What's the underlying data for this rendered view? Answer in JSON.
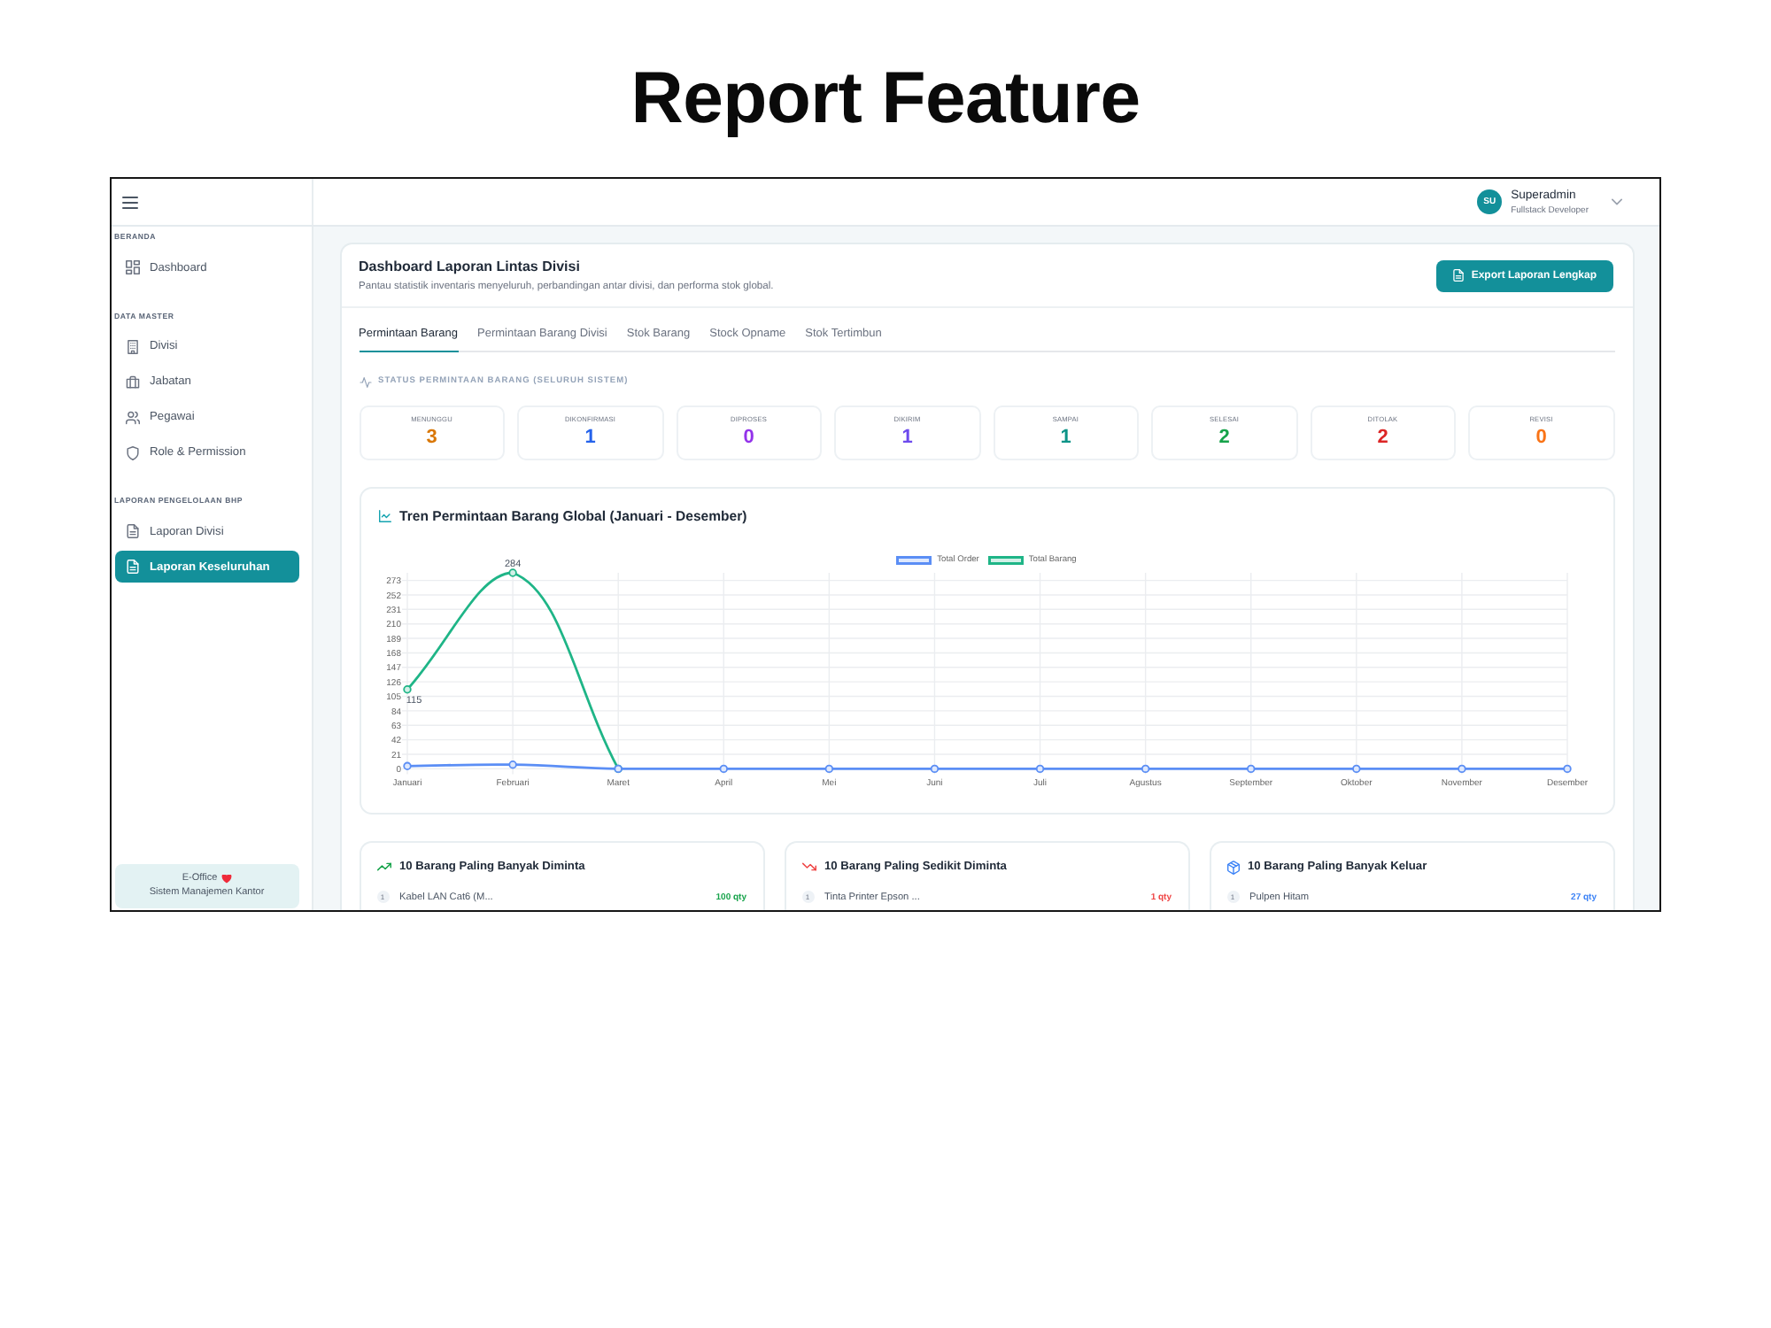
{
  "page_title": "Report Feature",
  "header": {
    "avatar_initials": "SU",
    "user_name": "Superadmin",
    "user_role": "Fullstack Developer"
  },
  "sidebar": {
    "groups": [
      {
        "label": "BERANDA",
        "items": [
          {
            "label": "Dashboard",
            "selected": false
          }
        ]
      },
      {
        "label": "DATA MASTER",
        "items": [
          {
            "label": "Divisi",
            "selected": false
          },
          {
            "label": "Jabatan",
            "selected": false
          },
          {
            "label": "Pegawai",
            "selected": false
          },
          {
            "label": "Role & Permission",
            "selected": false
          }
        ]
      },
      {
        "label": "LAPORAN PENGELOLAAN BHP",
        "items": [
          {
            "label": "Laporan Divisi",
            "selected": false
          },
          {
            "label": "Laporan Keseluruhan",
            "selected": true
          }
        ]
      }
    ],
    "footer": {
      "app_name": "E-Office",
      "tagline": "Sistem Manajemen Kantor"
    }
  },
  "report": {
    "title": "Dashboard Laporan Lintas Divisi",
    "subtitle": "Pantau statistik inventaris menyeluruh, perbandingan antar divisi, dan performa stok global.",
    "export_button": "Export Laporan Lengkap",
    "tabs": [
      {
        "label": "Permintaan Barang",
        "selected": true
      },
      {
        "label": "Permintaan Barang Divisi",
        "selected": false
      },
      {
        "label": "Stok Barang",
        "selected": false
      },
      {
        "label": "Stock Opname",
        "selected": false
      },
      {
        "label": "Stok Tertimbun",
        "selected": false
      }
    ],
    "status_section": {
      "heading": "STATUS PERMINTAAN BARANG (SELURUH SISTEM)",
      "items": [
        {
          "label": "MENUNGGU",
          "value": "3",
          "color": "#d97706"
        },
        {
          "label": "DIKONFIRMASI",
          "value": "1",
          "color": "#2563eb"
        },
        {
          "label": "DIPROSES",
          "value": "0",
          "color": "#9333ea"
        },
        {
          "label": "DIKIRIM",
          "value": "1",
          "color": "#6d4aed"
        },
        {
          "label": "SAMPAI",
          "value": "1",
          "color": "#0d9488"
        },
        {
          "label": "SELESAI",
          "value": "2",
          "color": "#16a34a"
        },
        {
          "label": "DITOLAK",
          "value": "2",
          "color": "#dc2626"
        },
        {
          "label": "REVISI",
          "value": "0",
          "color": "#f97316"
        }
      ]
    },
    "trend_chart": {
      "chart_data": {
        "type": "line",
        "title": "Tren Permintaan Barang Global (Januari - Desember)",
        "categories": [
          "Januari",
          "Februari",
          "Maret",
          "April",
          "Mei",
          "Juni",
          "Juli",
          "Agustus",
          "September",
          "Oktober",
          "November",
          "Desember"
        ],
        "series": [
          {
            "name": "Total Order",
            "color": "#5b8ef5",
            "marker": "circle",
            "values": [
              4,
              6,
              0,
              0,
              0,
              0,
              0,
              0,
              0,
              0,
              0,
              0
            ]
          },
          {
            "name": "Total Barang",
            "color": "#1fb587",
            "marker": "circle",
            "values": [
              115,
              284,
              0,
              null,
              null,
              null,
              null,
              null,
              null,
              null,
              null,
              null
            ]
          }
        ],
        "ylim": [
          0,
          284
        ],
        "yticks": [
          {
            "value": 0,
            "label": "0"
          },
          21,
          42,
          63,
          84,
          105,
          126,
          147,
          168,
          189,
          210,
          231,
          252,
          273
        ],
        "grid": true,
        "legend": "top",
        "annotations": [
          {
            "x": "Januari",
            "y": 115,
            "text": "115"
          },
          {
            "x": "Februari",
            "y": 284,
            "text": "284"
          }
        ]
      }
    },
    "top_lists": [
      {
        "kind": "rising",
        "title": "10 Barang Paling Banyak Diminta",
        "color": "#16a34a",
        "rows": [
          {
            "rank": "1",
            "name": "Kabel LAN Cat6 (M...",
            "qty": "100 qty"
          }
        ]
      },
      {
        "kind": "falling",
        "title": "10 Barang Paling Sedikit Diminta",
        "color": "#ef4444",
        "rows": [
          {
            "rank": "1",
            "name": "Tinta Printer Epson ...",
            "qty": "1 qty"
          }
        ]
      },
      {
        "kind": "outgoing",
        "title": "10 Barang Paling Banyak Keluar",
        "color": "#3b82f6",
        "rows": [
          {
            "rank": "1",
            "name": "Pulpen Hitam",
            "qty": "27 qty"
          }
        ]
      }
    ]
  }
}
